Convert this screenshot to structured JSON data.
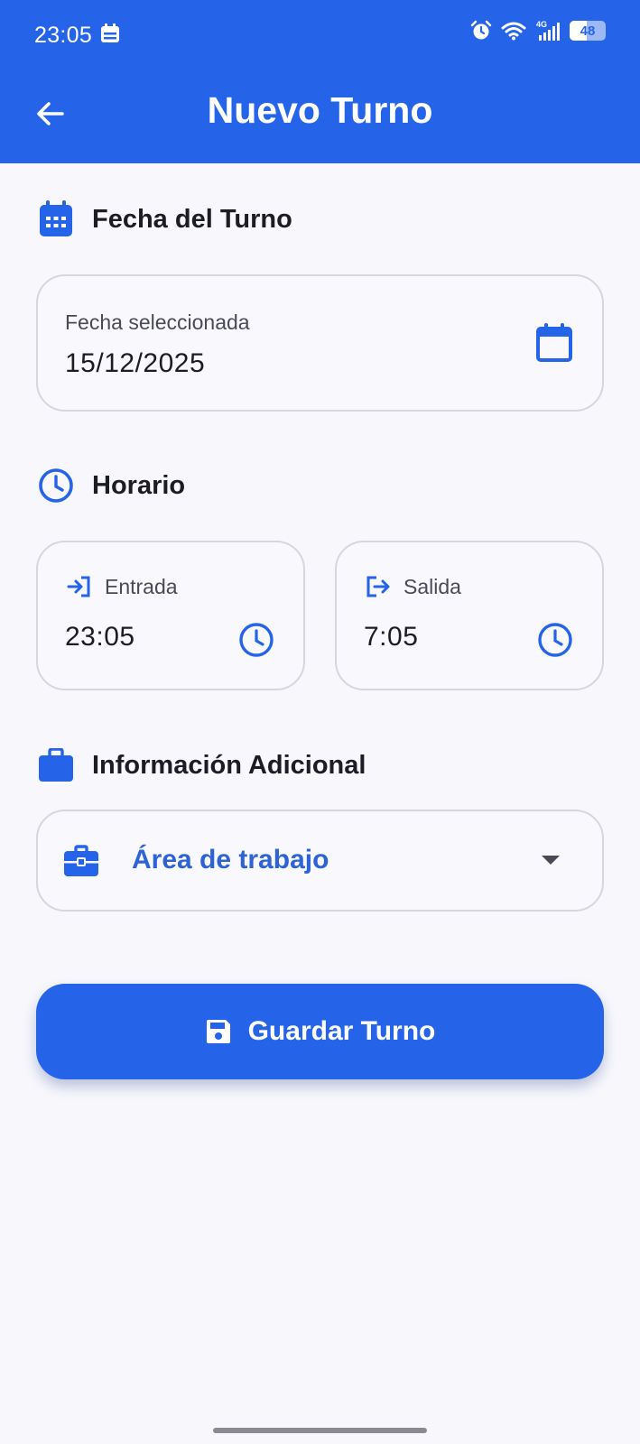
{
  "status_bar": {
    "time": "23:05",
    "battery": "48"
  },
  "header": {
    "title": "Nuevo Turno"
  },
  "date_section": {
    "title": "Fecha del Turno",
    "field_label": "Fecha seleccionada",
    "field_value": "15/12/2025"
  },
  "schedule_section": {
    "title": "Horario",
    "entry": {
      "label": "Entrada",
      "value": "23:05"
    },
    "exit": {
      "label": "Salida",
      "value": "7:05"
    }
  },
  "info_section": {
    "title": "Información Adicional",
    "work_area_placeholder": "Área de trabajo"
  },
  "save_button": {
    "label": "Guardar Turno"
  },
  "colors": {
    "primary": "#2563e8",
    "background": "#f7f7fc",
    "border": "#d6d6de"
  }
}
